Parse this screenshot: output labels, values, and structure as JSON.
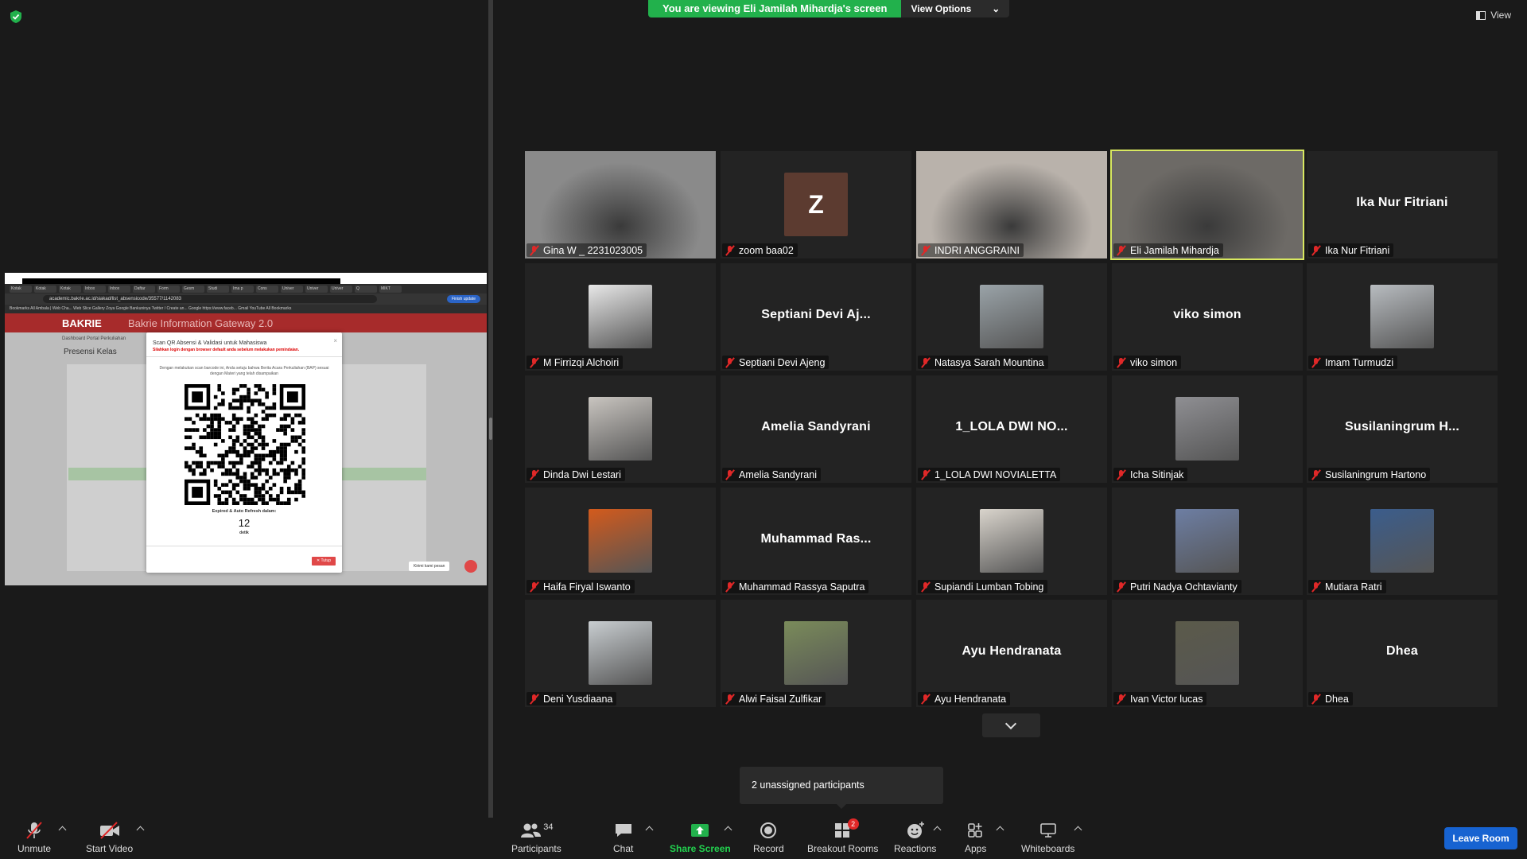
{
  "banner": {
    "viewing": "You are viewing Eli Jamilah Mihardja's screen",
    "view_options": "View Options",
    "view": "View"
  },
  "shared_screen": {
    "tabs": [
      "Kotak",
      "Kotak",
      "Kotak",
      "Inbox",
      "Inbox",
      "Daftar",
      "Form",
      "Gesm",
      "Studi",
      "Ima p",
      "Cons",
      "Univer",
      "Univer",
      "Univer",
      "Q",
      "MIKT"
    ],
    "url": "academic.bakrie.ac.id/siakad/list_absensicode/35577/1142083",
    "finish_update": "Finish update",
    "bookmarks": "Bookmarks   All   Ambala | Web Cha...   Web Slice Gallery   Zoya   Google   Bankuninya   Twitter / Create an...   Google   https://www.faceb...   Gmail   YouTube                         All Bookmarks",
    "logo": "BAKRIE",
    "site_title": "Bakrie Information Gateway 2.0",
    "menu": "Dashboard    Portal    Perkuliahan",
    "page_heading": "Presensi Kelas",
    "modal_title": "Scan QR Absensi & Validasi untuk Mahasiswa",
    "modal_warning": "Silahkan login dengan browser default anda sebelum melakukan pemindaian.",
    "modal_instruction": "Dengan melakukan scan barcode ini, Anda setuju bahwa Berita Acara Perkuliahan (BAP) sesuai dengan Materi yang telah disampaikan",
    "expired_label": "Expired & Auto Refresh dalam:",
    "countdown": "12",
    "countdown_unit": "detik",
    "close_button": "✕ Tutup",
    "chat_prompt": "Kirimi kami pesan"
  },
  "participants": [
    {
      "name": "Gina W _ 2231023005",
      "display": "video",
      "color": "#8a8a8a"
    },
    {
      "name": "zoom baa02",
      "display": "letter",
      "letter": "Z"
    },
    {
      "name": "INDRI ANGGRAINI",
      "display": "video",
      "color": "#b9b2ab"
    },
    {
      "name": "Eli Jamilah Mihardja",
      "display": "video",
      "color": "#6d6a66",
      "active": true
    },
    {
      "name": "Ika Nur Fitriani",
      "display": "name",
      "center": "Ika Nur Fitriani"
    },
    {
      "name": "M Firrizqi Alchoiri",
      "display": "photo",
      "color": "#e8e8e8"
    },
    {
      "name": "Septiani Devi Ajeng",
      "display": "name",
      "center": "Septiani  Devi  Aj..."
    },
    {
      "name": "Natasya Sarah Mountina",
      "display": "photo",
      "color": "#9aa3a8"
    },
    {
      "name": "viko simon",
      "display": "name",
      "center": "viko simon"
    },
    {
      "name": "Imam Turmudzi",
      "display": "photo",
      "color": "#b8bcc0"
    },
    {
      "name": "Dinda Dwi Lestari",
      "display": "photo",
      "color": "#c9c5c0"
    },
    {
      "name": "Amelia Sandyrani",
      "display": "name",
      "center": "Amelia Sandyrani"
    },
    {
      "name": "1_LOLA DWI NOVIALETTA",
      "display": "name",
      "center": "1_LOLA  DWI  NO..."
    },
    {
      "name": "Icha Sitinjak",
      "display": "photo",
      "color": "#8f8f93"
    },
    {
      "name": "Susilaningrum Hartono",
      "display": "name",
      "center": "Susilaningrum  H..."
    },
    {
      "name": "Haifa Firyal Iswanto",
      "display": "photo",
      "color": "#d35a1c"
    },
    {
      "name": "Muhammad Rassya Saputra",
      "display": "name",
      "center": "Muhammad  Ras..."
    },
    {
      "name": "Supiandi Lumban Tobing",
      "display": "photo",
      "color": "#d9d4cc"
    },
    {
      "name": "Putri Nadya Ochtavianty",
      "display": "photo",
      "color": "#6d7ea3"
    },
    {
      "name": "Mutiara Ratri",
      "display": "photo",
      "color": "#3b5d8c"
    },
    {
      "name": "Deni Yusdiaana",
      "display": "photo",
      "color": "#c8cdd0"
    },
    {
      "name": "Alwi Faisal Zulfikar",
      "display": "photo",
      "color": "#7a8b5a"
    },
    {
      "name": "Ayu Hendranata",
      "display": "name",
      "center": "Ayu Hendranata"
    },
    {
      "name": "Ivan Victor lucas",
      "display": "photo",
      "color": "#5b5a4a"
    },
    {
      "name": "Dhea",
      "display": "name",
      "center": "Dhea"
    }
  ],
  "unassigned": "2 unassigned participants",
  "toolbar": {
    "unmute": "Unmute",
    "start_video": "Start Video",
    "participants": "Participants",
    "participants_count": "34",
    "chat": "Chat",
    "share_screen": "Share Screen",
    "record": "Record",
    "breakout_rooms": "Breakout Rooms",
    "breakout_badge": "2",
    "reactions": "Reactions",
    "apps": "Apps",
    "whiteboards": "Whiteboards",
    "leave": "Leave Room"
  },
  "colors": {
    "accent_green": "#22b14c",
    "leave_blue": "#1763d1",
    "active_speaker": "#d8e860",
    "mute_red": "#e02828"
  }
}
